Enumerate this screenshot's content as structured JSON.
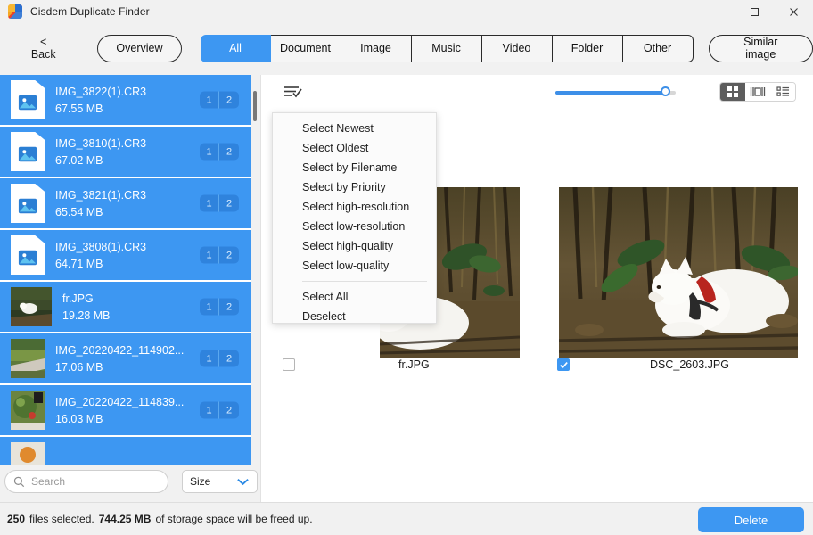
{
  "window": {
    "title": "Cisdem Duplicate Finder",
    "controls": [
      {
        "name": "minimize-button",
        "glyph": "minimize"
      },
      {
        "name": "maximize-button",
        "glyph": "maximize"
      },
      {
        "name": "close-button",
        "glyph": "close"
      }
    ]
  },
  "toolbar": {
    "back_label": "< Back",
    "overview_label": "Overview",
    "similar_image_label": "Similar image",
    "tabs": [
      {
        "label": "All",
        "active": true
      },
      {
        "label": "Document",
        "active": false
      },
      {
        "label": "Image",
        "active": false
      },
      {
        "label": "Music",
        "active": false
      },
      {
        "label": "Video",
        "active": false
      },
      {
        "label": "Folder",
        "active": false
      },
      {
        "label": "Other",
        "active": false
      }
    ]
  },
  "sidebar": {
    "files": [
      {
        "name": "IMG_3822(1).CR3",
        "size": "67.55 MB",
        "icon": "image-file-icon",
        "thumb": "doc",
        "count_a": "1",
        "count_b": "2"
      },
      {
        "name": "IMG_3810(1).CR3",
        "size": "67.02 MB",
        "icon": "image-file-icon",
        "thumb": "doc",
        "count_a": "1",
        "count_b": "2"
      },
      {
        "name": "IMG_3821(1).CR3",
        "size": "65.54 MB",
        "icon": "image-file-icon",
        "thumb": "doc",
        "count_a": "1",
        "count_b": "2"
      },
      {
        "name": "IMG_3808(1).CR3",
        "size": "64.71 MB",
        "icon": "image-file-icon",
        "thumb": "doc",
        "count_a": "1",
        "count_b": "2"
      },
      {
        "name": "fr.JPG",
        "size": "19.28 MB",
        "icon": "photo-thumbnail",
        "thumb": "photo-dog",
        "count_a": "1",
        "count_b": "2"
      },
      {
        "name": "IMG_20220422_114902...",
        "size": "17.06 MB",
        "icon": "photo-thumbnail",
        "thumb": "photo-path",
        "count_a": "1",
        "count_b": "2"
      },
      {
        "name": "IMG_20220422_114839...",
        "size": "16.03 MB",
        "icon": "photo-thumbnail",
        "thumb": "photo-plant",
        "count_a": "1",
        "count_b": "2"
      }
    ],
    "search": {
      "placeholder": "Search",
      "value": "",
      "icon": "search-icon"
    },
    "sort": {
      "label": "Size",
      "icon": "chevron-down-icon"
    }
  },
  "main": {
    "select_menu_icon": "list-check-icon",
    "slider": {
      "value": 92,
      "min": 0,
      "max": 100
    },
    "view_modes": [
      {
        "name": "grid-view",
        "icon": "grid-icon",
        "active": true
      },
      {
        "name": "single-view",
        "icon": "single-pane-icon",
        "active": false
      },
      {
        "name": "list-view",
        "icon": "list-icon",
        "active": false
      }
    ],
    "items": [
      {
        "label": "fr.JPG",
        "checked": false,
        "image": "samoyed-dog-forest-left"
      },
      {
        "label": "DSC_2603.JPG",
        "checked": true,
        "image": "samoyed-dog-forest-right"
      }
    ]
  },
  "dropdown": {
    "items": [
      "Select Newest",
      "Select Oldest",
      "Select by Filename",
      "Select by Priority",
      "Select high-resolution",
      "Select low-resolution",
      "Select high-quality",
      "Select low-quality"
    ],
    "items_bottom": [
      "Select All",
      "Deselect"
    ]
  },
  "status": {
    "count": "250",
    "count_suffix": "files selected.",
    "size": "744.25 MB",
    "size_suffix": "of storage space will be freed up.",
    "delete_label": "Delete"
  },
  "colors": {
    "accent": "#3d97f2",
    "selected_row": "#3d97f2",
    "chrome": "#f1f1f1"
  }
}
